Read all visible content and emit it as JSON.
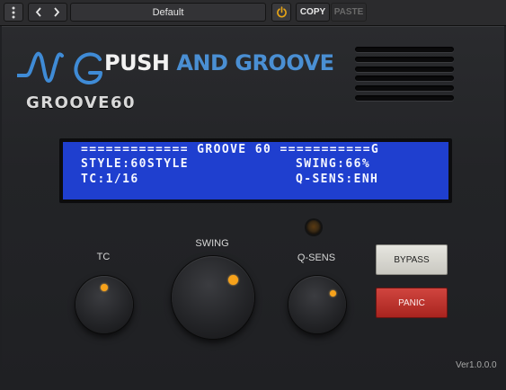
{
  "toolbar": {
    "preset_name": "Default",
    "copy_label": "COPY",
    "paste_label": "PASTE",
    "icons": [
      "menu-dots-icon",
      "chevron-left-icon",
      "chevron-right-icon",
      "power-icon"
    ],
    "power_color": "#e8a516"
  },
  "brand": {
    "name_part1": "PUSH",
    "name_part2": "AND GROOVE",
    "product": "GROOVE60",
    "accent_color": "#4a8fd3"
  },
  "lcd": {
    "line1": "============= GROOVE 60 ===========G",
    "line2_left": "STYLE:60STYLE",
    "line2_right": "SWING:66%",
    "line3_left": "TC:1/16",
    "line3_right": "Q-SENS:ENH",
    "background_color": "#1f3fcf"
  },
  "knobs": {
    "tc_label": "TC",
    "swing_label": "SWING",
    "qsens_label": "Q-SENS",
    "dot_color": "#f7a21a"
  },
  "buttons": {
    "bypass_label": "BYPASS",
    "panic_label": "PANIC"
  },
  "version": "Ver1.0.0.0"
}
